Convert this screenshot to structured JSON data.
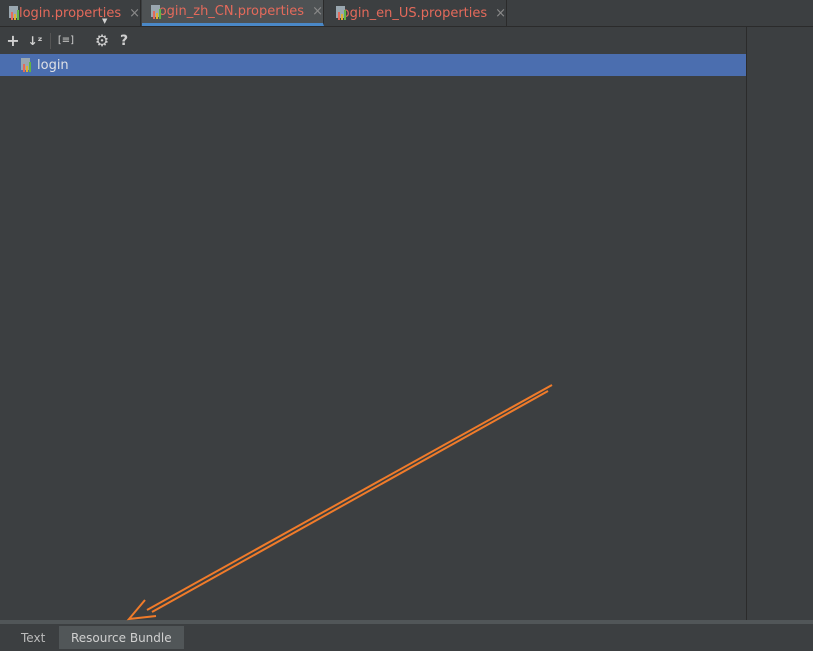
{
  "tabs": [
    {
      "label": "login.properties",
      "close": "×",
      "active": false
    },
    {
      "label": "login_zh_CN.properties",
      "close": "×",
      "active": true
    },
    {
      "label": "login_en_US.properties",
      "close": "×",
      "active": false
    }
  ],
  "toolbar": {
    "add": "+",
    "sort": "↓ᶻ",
    "group": "[≡]",
    "settings": "⚙",
    "help": "?"
  },
  "tree": {
    "items": [
      {
        "label": "login",
        "selected": true
      }
    ]
  },
  "bottom_tabs": [
    {
      "label": "Text",
      "active": false
    },
    {
      "label": "Resource Bundle",
      "active": true
    }
  ],
  "colors": {
    "background": "#3c3f41",
    "selection": "#4b6eaf",
    "tab_label": "#e46a5b",
    "annotation_arrow": "#f07b2a"
  }
}
